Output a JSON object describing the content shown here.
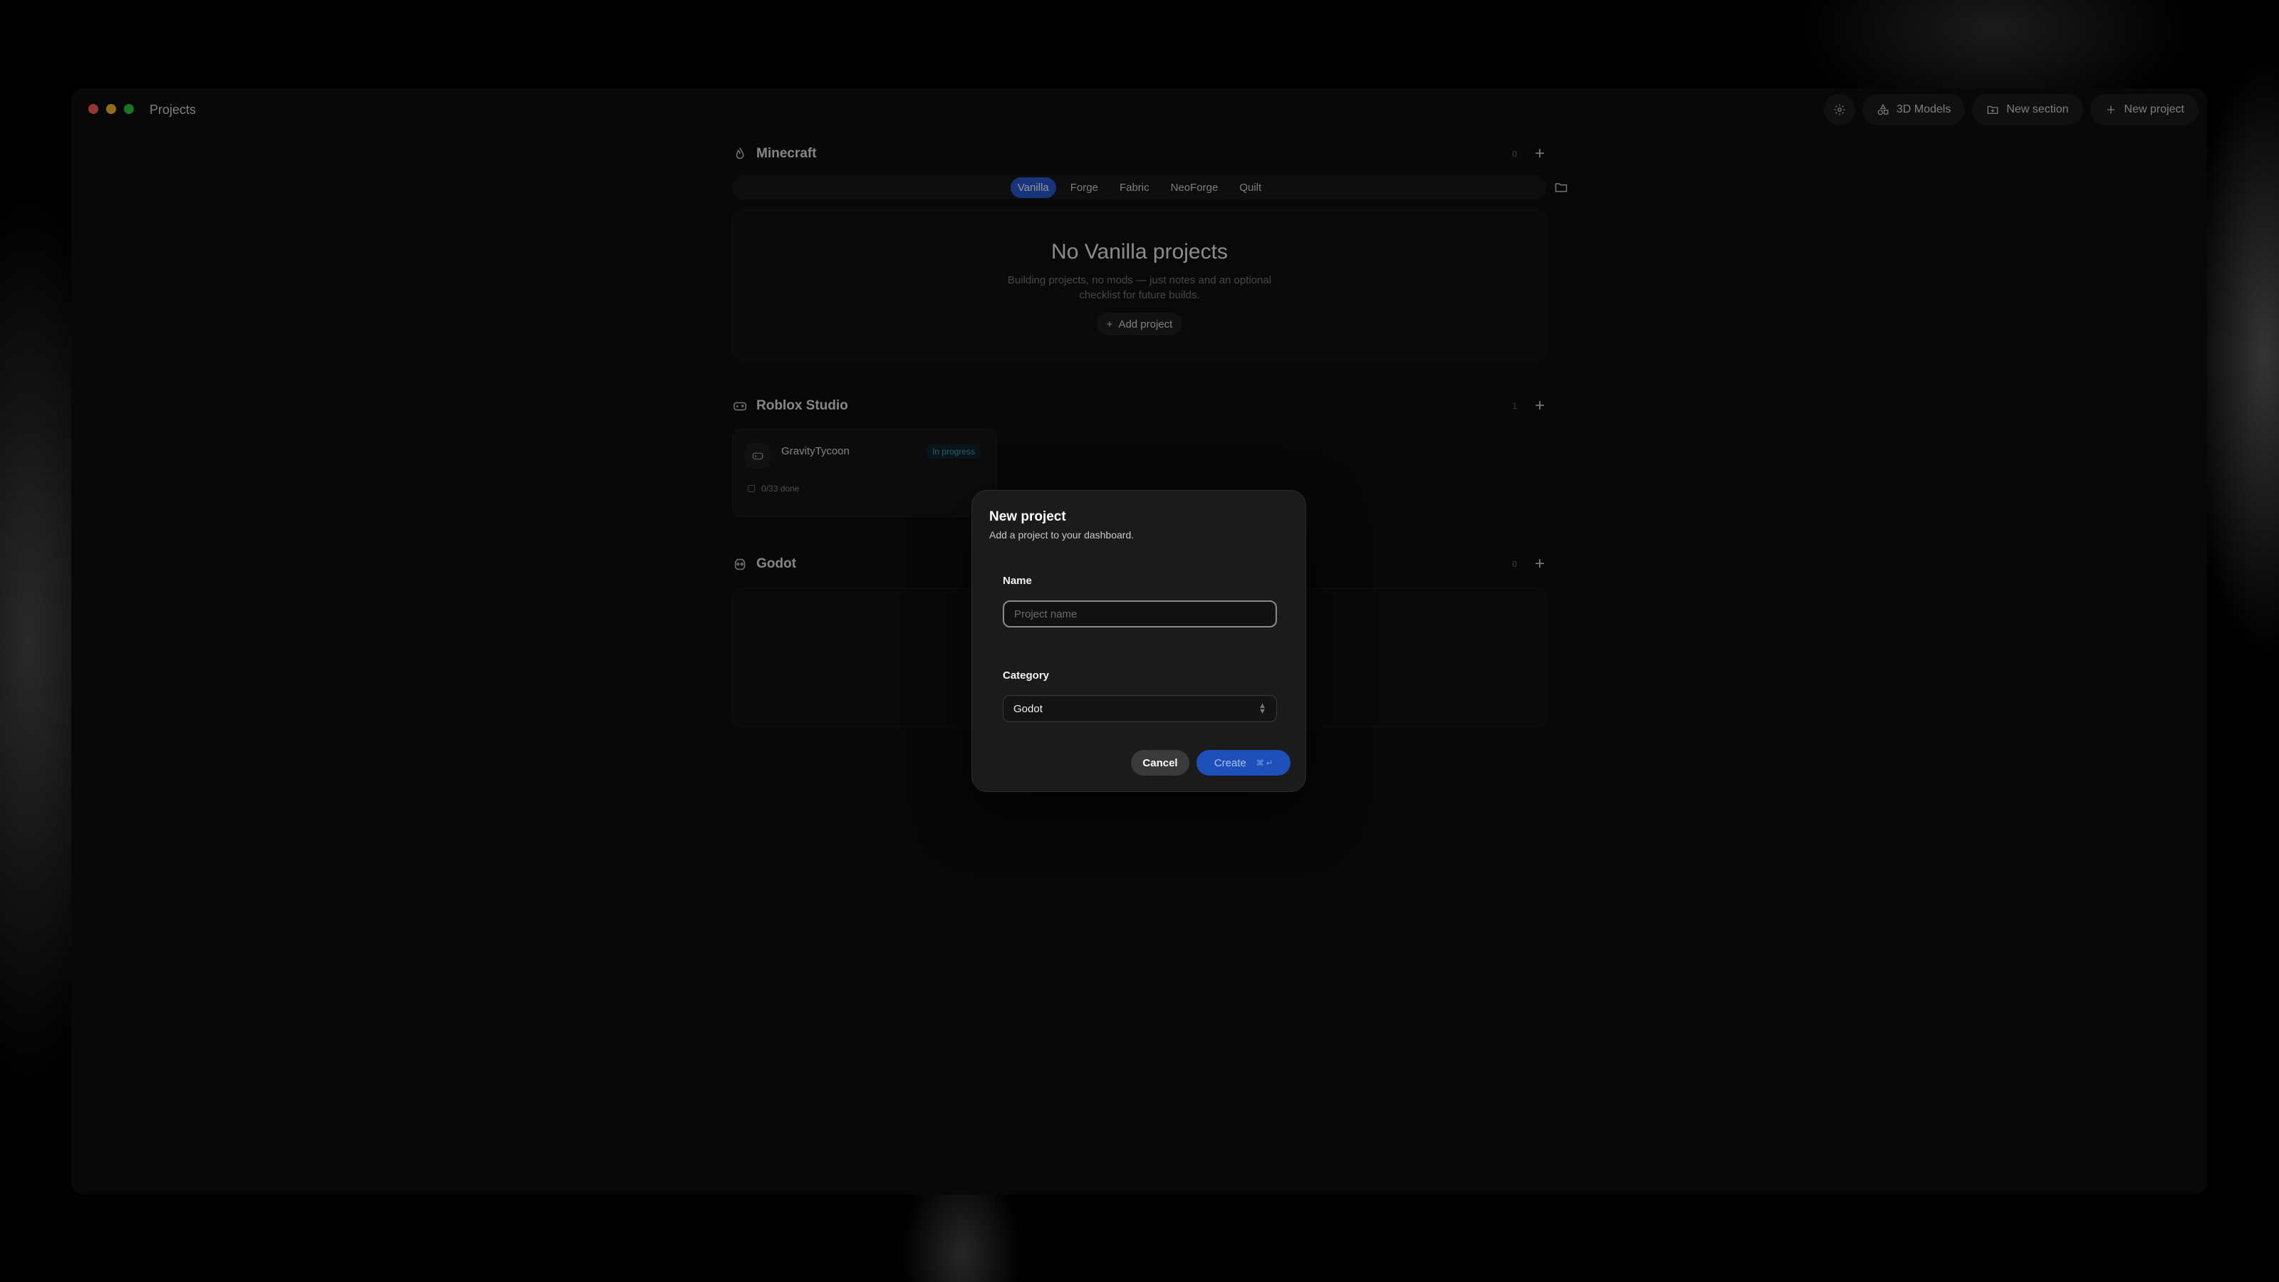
{
  "window": {
    "title": "Projects"
  },
  "toolbar": {
    "settings_icon": "gear-icon",
    "models_label": "3D Models",
    "new_section_label": "New section",
    "new_project_label": "New project"
  },
  "sections": {
    "minecraft": {
      "title": "Minecraft",
      "count": "0",
      "tabs": [
        "Vanilla",
        "Forge",
        "Fabric",
        "NeoForge",
        "Quilt"
      ],
      "active_tab": "Vanilla",
      "empty_title": "No Vanilla projects",
      "empty_desc": "Building projects, no mods — just notes and an optional checklist for future builds.",
      "add_label": "Add project"
    },
    "roblox": {
      "title": "Roblox Studio",
      "count": "1",
      "card": {
        "name": "GravityTycoon",
        "status": "In progress",
        "progress": "0/33 done"
      }
    },
    "godot": {
      "title": "Godot",
      "count": "0"
    }
  },
  "modal": {
    "title": "New project",
    "subtitle": "Add a project to your dashboard.",
    "name_label": "Name",
    "name_placeholder": "Project name",
    "name_value": "",
    "category_label": "Category",
    "category_value": "Godot",
    "cancel_label": "Cancel",
    "create_label": "Create",
    "create_shortcut": "⌘ ↵"
  },
  "colors": {
    "accent": "#2a5bd7",
    "badge_text": "#3aa6c9",
    "window_bg": "#0f0f0f"
  }
}
